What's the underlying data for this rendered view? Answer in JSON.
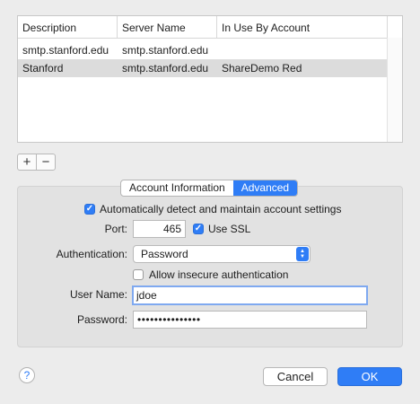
{
  "table": {
    "columns": [
      "Description",
      "Server Name",
      "In Use By Account"
    ],
    "rows": [
      {
        "description": "smtp.stanford.edu",
        "server": "smtp.stanford.edu",
        "account": ""
      },
      {
        "description": "Stanford",
        "server": "smtp.stanford.edu",
        "account": "ShareDemo Red"
      }
    ],
    "selected_row": 1
  },
  "controls": {
    "add_label": "+",
    "remove_label": "−"
  },
  "tabs": [
    {
      "label": "Account Information",
      "active": false
    },
    {
      "label": "Advanced",
      "active": true
    }
  ],
  "advanced": {
    "auto_detect_label": "Automatically detect and maintain account settings",
    "auto_detect_checked": true,
    "port_label": "Port:",
    "port_value": "465",
    "use_ssl_label": "Use SSL",
    "use_ssl_checked": true,
    "authentication_label": "Authentication:",
    "authentication_value": "Password",
    "allow_insecure_label": "Allow insecure authentication",
    "allow_insecure_checked": false,
    "username_label": "User Name:",
    "username_value": "jdoe",
    "password_label": "Password:",
    "password_value": "•••••••••••••••"
  },
  "footer": {
    "help_label": "?",
    "cancel_label": "Cancel",
    "ok_label": "OK"
  },
  "colors": {
    "accent": "#2f7df6",
    "window_bg": "#ececec",
    "selected_row": "#dcdcdc"
  }
}
